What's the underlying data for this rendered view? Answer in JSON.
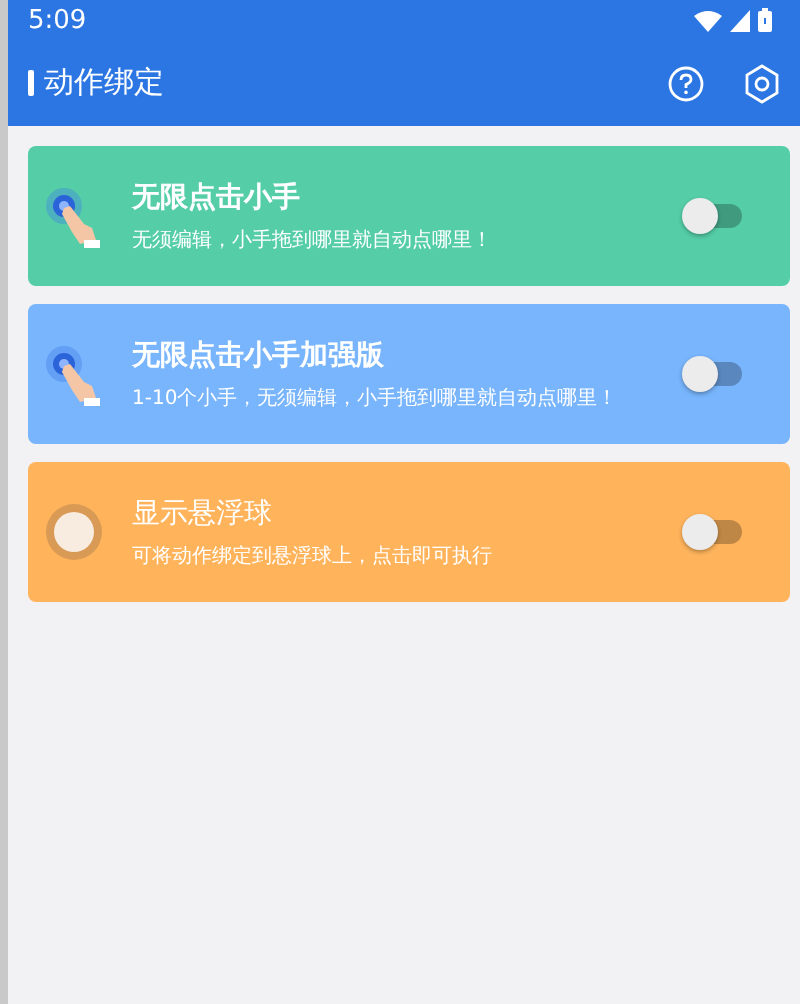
{
  "status_bar": {
    "time": "5:09"
  },
  "toolbar": {
    "title": "动作绑定"
  },
  "cards": [
    {
      "kind": "hand",
      "color": "#55cea8",
      "title": "无限点击小手",
      "subtitle": "无须编辑，小手拖到哪里就自动点哪里！",
      "on": false
    },
    {
      "kind": "hand",
      "color": "#78b5fc",
      "title": "无限点击小手加强版",
      "subtitle": "1-10个小手，无须编辑，小手拖到哪里就自动点哪里！",
      "on": false
    },
    {
      "kind": "ball",
      "color": "#ffb45c",
      "title": "显示悬浮球",
      "subtitle": "可将动作绑定到悬浮球上，点击即可执行",
      "on": false
    }
  ]
}
